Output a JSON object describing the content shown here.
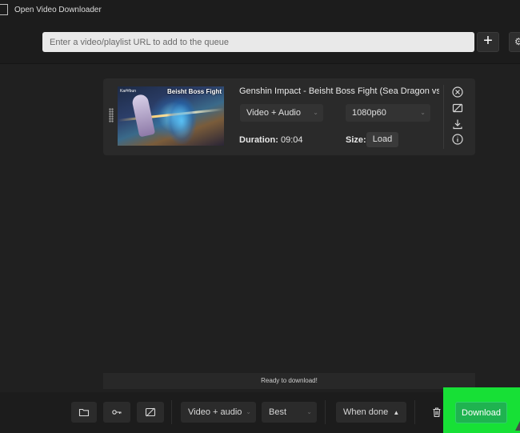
{
  "window": {
    "title": "Open Video Downloader"
  },
  "toolbar": {
    "url_placeholder": "Enter a video/playlist URL to add to the queue",
    "add_label": "+",
    "more_label": "⚙"
  },
  "queue": [
    {
      "title": "Genshin Impact - Beisht Boss Fight (Sea Dragon vs",
      "thumbnail_text": "Beisht Boss Fight",
      "thumbnail_tag": "Ka##bun",
      "format": "Video + Audio",
      "resolution": "1080p60",
      "duration_label": "Duration:",
      "duration": "09:04",
      "size_label": "Size:",
      "load_label": "Load"
    }
  ],
  "status": {
    "text": "Ready to download!"
  },
  "bottom": {
    "format": "Video + audio",
    "quality": "Best",
    "when_done": "When done",
    "when_done_chevron": "▲",
    "download_label": "Download"
  },
  "icons": {
    "remove": "close-circle-icon",
    "no_subtitles": "subtitles-off-icon",
    "download": "download-icon",
    "info": "info-icon",
    "folder": "folder-icon",
    "key": "key-icon",
    "subtitles": "subtitles-off-icon",
    "trash": "trash-icon"
  },
  "colors": {
    "background": "#202020",
    "accent": "#1fb350",
    "highlight": "#17e036"
  }
}
